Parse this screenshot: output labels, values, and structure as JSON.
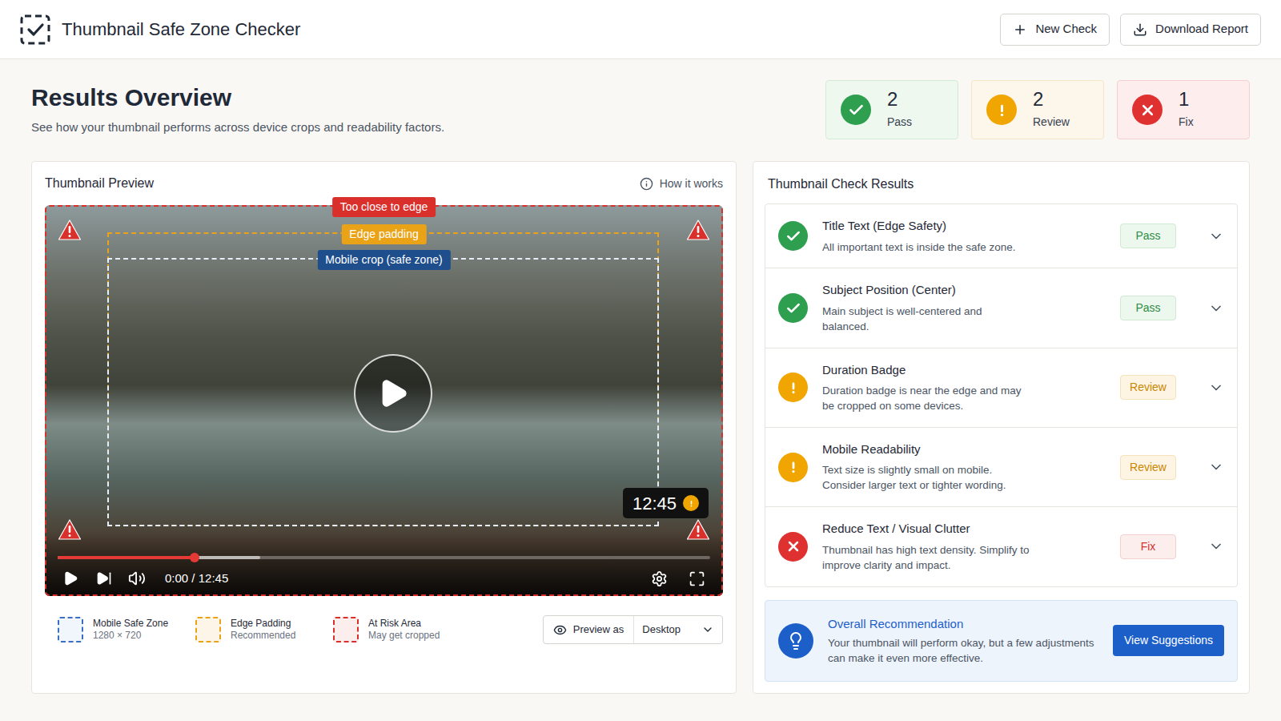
{
  "app": {
    "title": "Thumbnail Safe Zone Checker"
  },
  "header_buttons": [
    {
      "label": "New Check",
      "kind": "new"
    },
    {
      "label": "Download Report",
      "kind": "download"
    }
  ],
  "overview": {
    "title": "Results Overview",
    "subtitle": "See how your thumbnail performs across device crops and readability factors."
  },
  "summary": [
    {
      "count": "2",
      "label": "Pass",
      "kind": "pass"
    },
    {
      "count": "2",
      "label": "Review",
      "kind": "review"
    },
    {
      "count": "1",
      "label": "Fix",
      "kind": "fix"
    }
  ],
  "preview": {
    "title": "Thumbnail Preview",
    "help": "How it works",
    "zones": [
      {
        "label": "Too close to edge",
        "kind": "risk"
      },
      {
        "label": "Edge padding",
        "kind": "padding"
      },
      {
        "label": "Mobile crop (safe zone)",
        "kind": "safe"
      }
    ],
    "duration_badge": "12:45",
    "player": {
      "time": "0:00 / 12:45",
      "level": 0.21,
      "buffer_level": 0.31
    },
    "legend": [
      {
        "label": "Mobile Safe Zone",
        "detail": "1280 × 720",
        "kind": "safe"
      },
      {
        "label": "Edge Padding",
        "detail": "Recommended",
        "kind": "padding"
      },
      {
        "label": "At Risk Area",
        "detail": "May get cropped",
        "kind": "risk"
      }
    ],
    "preview_as": {
      "label": "Preview as",
      "value": "Desktop"
    }
  },
  "results": {
    "title": "Thumbnail Check Results",
    "items": [
      {
        "title": "Title Text (Edge Safety)",
        "description": "All important text is inside the safe zone.",
        "status": "Pass",
        "kind": "pass",
        "expanded": false
      },
      {
        "title": "Subject Position (Center)",
        "description": "Main subject is well-centered and balanced.",
        "status": "Pass",
        "kind": "pass",
        "expanded": false
      },
      {
        "title": "Duration Badge",
        "description": "Duration badge is near the edge and may be cropped on some devices.",
        "status": "Review",
        "kind": "review",
        "expanded": false
      },
      {
        "title": "Mobile Readability",
        "description": "Text size is slightly small on mobile. Consider larger text or tighter wording.",
        "status": "Review",
        "kind": "review",
        "expanded": false
      },
      {
        "title": "Reduce Text / Visual Clutter",
        "description": "Thumbnail has high text density. Simplify to improve clarity and impact.",
        "status": "Fix",
        "kind": "fix",
        "expanded": false
      }
    ]
  },
  "recommendation": {
    "title": "Overall Recommendation",
    "text": "Your thumbnail will perform okay, but a few adjustments can make it even more effective.",
    "button": "View Suggestions"
  }
}
